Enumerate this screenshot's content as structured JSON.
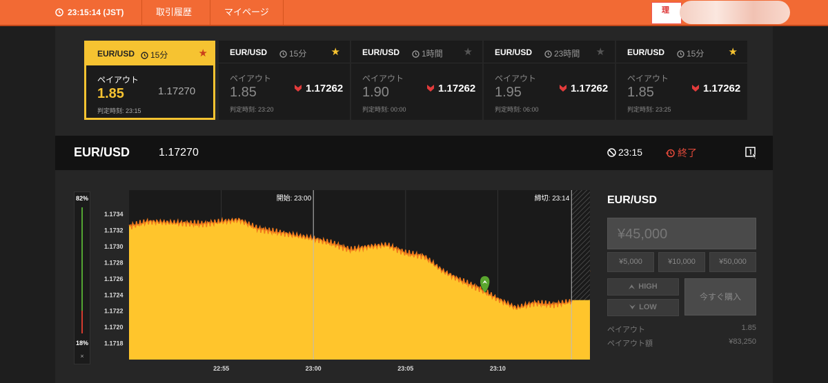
{
  "topbar": {
    "time": "23:15:14 (JST)",
    "nav": [
      "取引履歴",
      "マイページ"
    ],
    "right_button_label": "理"
  },
  "cards": [
    {
      "pair": "EUR/USD",
      "duration": "15分",
      "starred": true,
      "payout_label": "ペイアウト",
      "payout": "1.85",
      "rate": "1.17270",
      "direction": "none",
      "expiry": "判定時刻: 23:15",
      "active": true
    },
    {
      "pair": "EUR/USD",
      "duration": "15分",
      "starred": true,
      "payout_label": "ペイアウト",
      "payout": "1.85",
      "rate": "1.17262",
      "direction": "down",
      "expiry": "判定時刻: 23:20",
      "active": false
    },
    {
      "pair": "EUR/USD",
      "duration": "1時間",
      "starred": false,
      "payout_label": "ペイアウト",
      "payout": "1.90",
      "rate": "1.17262",
      "direction": "down",
      "expiry": "判定時刻: 00:00",
      "active": false
    },
    {
      "pair": "EUR/USD",
      "duration": "23時間",
      "starred": false,
      "payout_label": "ペイアウト",
      "payout": "1.95",
      "rate": "1.17262",
      "direction": "down",
      "expiry": "判定時刻: 06:00",
      "active": false
    },
    {
      "pair": "EUR/USD",
      "duration": "15分",
      "starred": true,
      "payout_label": "ペイアウト",
      "payout": "1.85",
      "rate": "1.17262",
      "direction": "down",
      "expiry": "判定時刻: 23:25",
      "active": false
    }
  ],
  "header": {
    "symbol": "EUR/USD",
    "price": "1.17270",
    "judge_time": "23:15",
    "status": "終了"
  },
  "sentiment": {
    "high_pct": "82%",
    "low_pct": "18%",
    "close_label": "×",
    "high_fraction": 0.82
  },
  "chart_data": {
    "type": "area",
    "x_ticks": [
      "22:55",
      "23:00",
      "23:05",
      "23:10"
    ],
    "y_ticks": [
      "1.1734",
      "1.1732",
      "1.1730",
      "1.1728",
      "1.1726",
      "1.1724",
      "1.1722",
      "1.1720",
      "1.1718"
    ],
    "ylim": [
      1.1716,
      1.1737
    ],
    "start_label": "開始: 23:00",
    "close_label": "締切: 23:14",
    "series": [
      {
        "x": [
          "22:50",
          "22:51",
          "22:52",
          "22:53",
          "22:54",
          "22:55",
          "22:56",
          "22:57",
          "22:58",
          "22:59",
          "23:00",
          "23:01",
          "23:02",
          "23:03",
          "23:04",
          "23:05",
          "23:06",
          "23:07",
          "23:08",
          "23:09",
          "23:10",
          "23:11",
          "23:12",
          "23:13",
          "23:14",
          "23:15"
        ],
        "values": [
          1.17325,
          1.17331,
          1.1733,
          1.17329,
          1.17328,
          1.17331,
          1.17333,
          1.17322,
          1.17318,
          1.17314,
          1.1731,
          1.17304,
          1.17296,
          1.173,
          1.17302,
          1.17292,
          1.17288,
          1.1727,
          1.17258,
          1.17248,
          1.17235,
          1.17224,
          1.1723,
          1.17228,
          1.17232,
          1.1727
        ]
      }
    ],
    "fill_color": "#ffc52c",
    "line_color": "#f07a1c"
  },
  "marker_label": "HIGH",
  "panel": {
    "symbol": "EUR/USD",
    "amount": "¥45,000",
    "chips": [
      "¥5,000",
      "¥10,000",
      "¥50,000"
    ],
    "high_label": "HIGH",
    "low_label": "LOW",
    "buy_label": "今すぐ購入",
    "payout_label": "ペイアウト",
    "payout_value": "1.85",
    "payout_amount_label": "ペイアウト額",
    "payout_amount_value": "¥83,250"
  },
  "colors": {
    "accent": "#f26a34",
    "active_card": "#f6c331",
    "down": "#e23b3b",
    "up": "#53a633"
  }
}
